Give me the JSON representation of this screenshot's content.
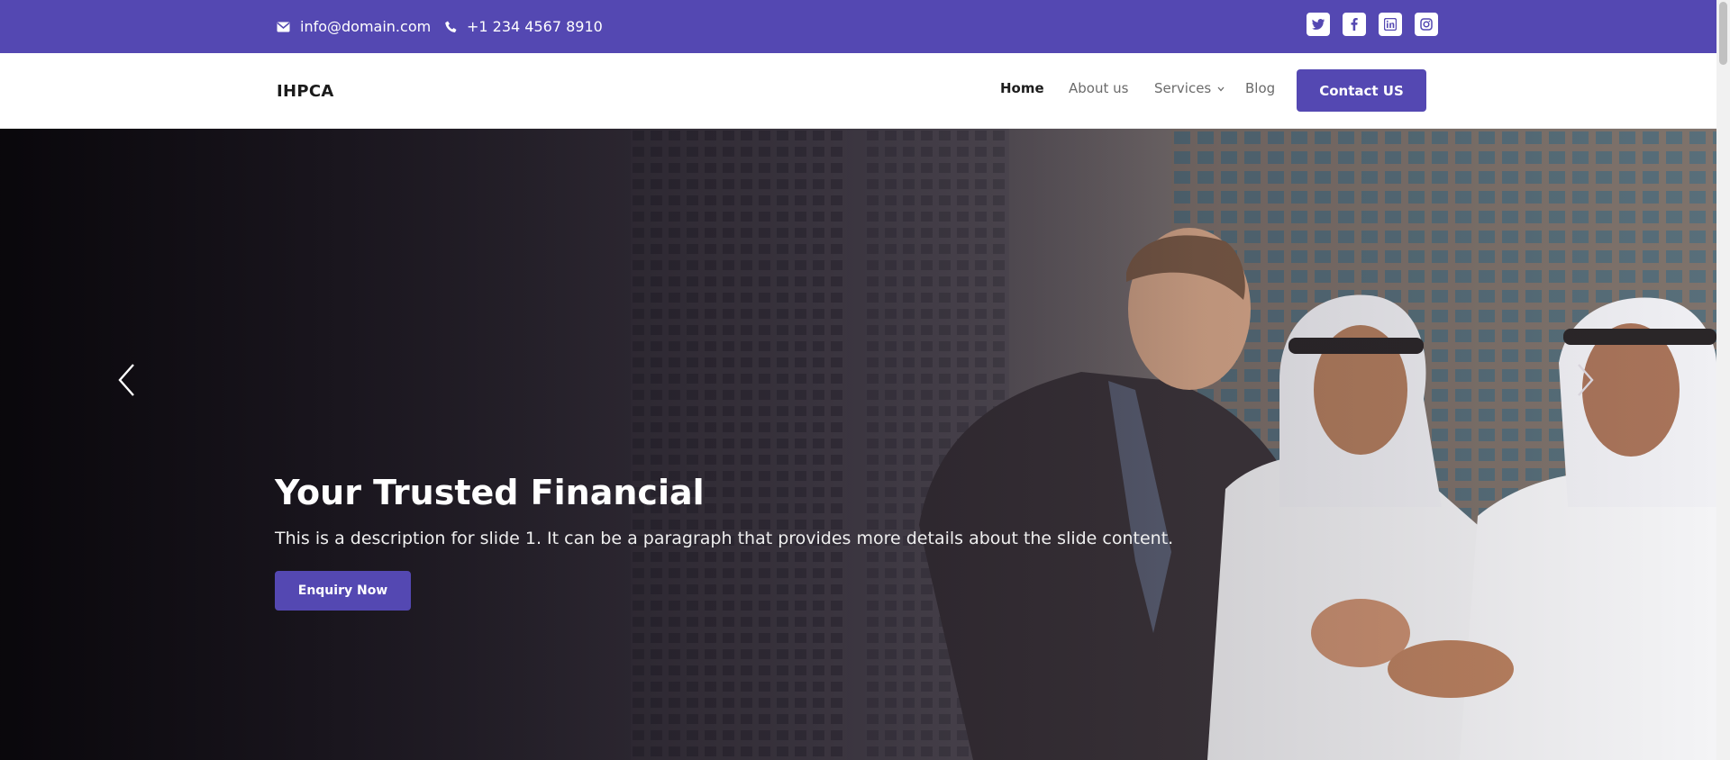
{
  "topbar": {
    "email": "info@domain.com",
    "phone": "+1 234 4567 8910",
    "social": [
      {
        "icon": "twitter-icon"
      },
      {
        "icon": "facebook-icon"
      },
      {
        "icon": "linkedin-icon"
      },
      {
        "icon": "instagram-icon"
      }
    ]
  },
  "nav": {
    "brand": "IHPCA",
    "items": [
      {
        "label": "Home",
        "active": true
      },
      {
        "label": "About us",
        "active": false
      },
      {
        "label": "Services",
        "active": false,
        "dropdown": true
      },
      {
        "label": "Blog",
        "active": false
      }
    ],
    "cta": "Contact US"
  },
  "hero": {
    "title": "Your Trusted Financial",
    "description": "This is a description for slide 1. It can be a paragraph that provides more details about the slide content.",
    "button": "Enquiry Now"
  },
  "colors": {
    "brand": "#5448b2",
    "white": "#ffffff"
  }
}
